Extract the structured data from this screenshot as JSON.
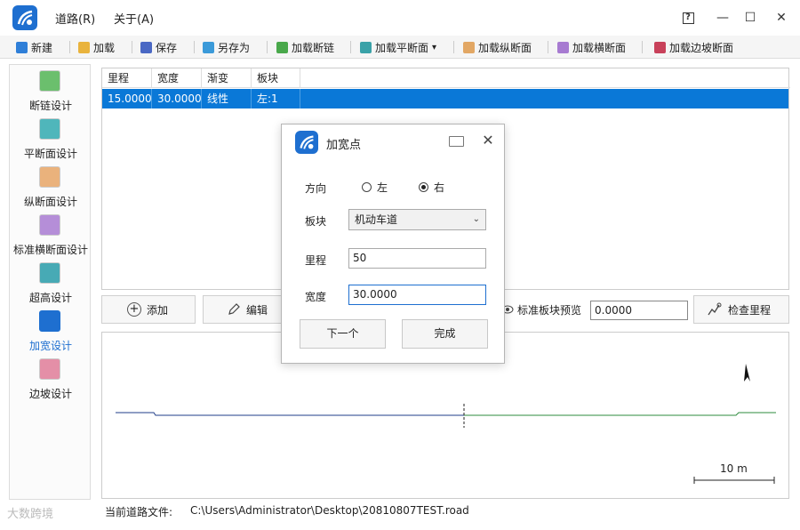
{
  "colors": {
    "accent": "#1e6fd0",
    "selection": "#0a78d7",
    "road_left": "#1f3c88",
    "road_right": "#2e8b3e"
  },
  "window": {
    "menus": [
      "道路(R)",
      "关于(A)"
    ],
    "help_label": "?",
    "min_glyph": "—",
    "max_glyph": "☐",
    "close_glyph": "✕"
  },
  "toolbar": {
    "items": [
      {
        "label": "新建",
        "icon": "new-file-icon",
        "color": "#2f7fd8"
      },
      {
        "label": "加载",
        "icon": "folder-icon",
        "color": "#e9b33d"
      },
      {
        "label": "保存",
        "icon": "save-icon",
        "color": "#4a68c4"
      },
      {
        "label": "另存为",
        "icon": "save-as-icon",
        "color": "#3b9ad9"
      },
      {
        "label": "加载断链",
        "icon": "chain-break-icon",
        "color": "#49a84b"
      },
      {
        "label": "加载平断面",
        "icon": "plane-section-icon",
        "color": "#3aa2a8"
      },
      {
        "label": "加载纵断面",
        "icon": "profile-icon",
        "color": "#e2a764"
      },
      {
        "label": "加载横断面",
        "icon": "cross-section-icon",
        "color": "#a77bd1"
      },
      {
        "label": "加载边坡断面",
        "icon": "slope-icon",
        "color": "#c8415a"
      }
    ],
    "dropdown_glyph": "▾"
  },
  "sidebar": {
    "items": [
      {
        "label": "断链设计",
        "icon": "chain-break-icon",
        "color": "#6bbf6d"
      },
      {
        "label": "平断面设计",
        "icon": "plane-section-icon",
        "color": "#4fb6bb"
      },
      {
        "label": "纵断面设计",
        "icon": "profile-icon",
        "color": "#eab27c"
      },
      {
        "label": "标准横断面设计",
        "icon": "cross-section-icon",
        "color": "#b58ed8"
      },
      {
        "label": "超高设计",
        "icon": "superelevation-icon",
        "color": "#47aab5"
      },
      {
        "label": "加宽设计",
        "icon": "widening-icon",
        "color": "#ffffff"
      },
      {
        "label": "边坡设计",
        "icon": "slope-icon",
        "color": "#e48fa7"
      }
    ],
    "active_index": 5
  },
  "table": {
    "headers": [
      "里程",
      "宽度",
      "渐变",
      "板块"
    ],
    "rows": [
      [
        "15.0000",
        "30.0000",
        "线性",
        "左:1"
      ]
    ]
  },
  "actions": {
    "add": "添加",
    "add_glyph": "+",
    "edit": "编辑",
    "preview": "标准板块预览",
    "value": "0.0000",
    "check": "检查里程"
  },
  "canvas": {
    "north_glyph": "▲",
    "scale_label": "10 m"
  },
  "status": {
    "label": "当前道路文件:",
    "path": "C:\\Users\\Administrator\\Desktop\\20810807TEST.road"
  },
  "watermark": "大数跨境",
  "dialog": {
    "title": "加宽点",
    "close_glyph": "✕",
    "direction_label": "方向",
    "left_option": "左",
    "right_option": "右",
    "selected_direction": "right",
    "block_label": "板块",
    "block_value": "机动车道",
    "block_chevron": "⌄",
    "station_label": "里程",
    "station_value": "50",
    "width_label": "宽度",
    "width_value": "30.0000",
    "next_button": "下一个",
    "finish_button": "完成"
  }
}
